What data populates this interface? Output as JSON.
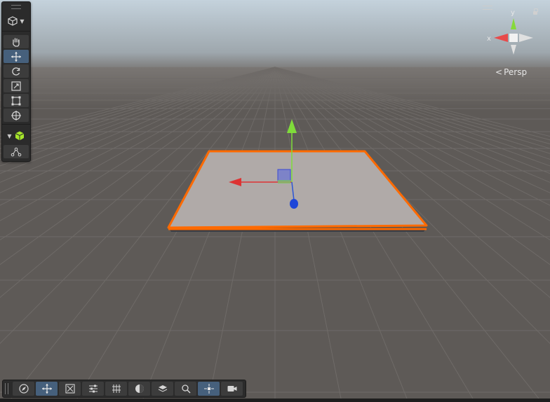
{
  "viewport": {
    "camera_mode_label": "Persp",
    "gizmo_axes": {
      "x": "x",
      "y": "y"
    },
    "sky_color_top": "#bccbd6",
    "ground_color": "#5e5a57",
    "selection_outline_color": "#ff6a00",
    "plane_color": "#b0aaa8"
  },
  "tool_palette": {
    "tools": [
      {
        "name": "hand-tool",
        "icon": "hand-icon",
        "active": false
      },
      {
        "name": "move-tool",
        "icon": "move-arrows-icon",
        "active": true
      },
      {
        "name": "rotate-tool",
        "icon": "rotate-icon",
        "active": false
      },
      {
        "name": "scale-tool",
        "icon": "scale-icon",
        "active": false
      },
      {
        "name": "rect-tool",
        "icon": "rect-transform-icon",
        "active": false
      },
      {
        "name": "transform-tool",
        "icon": "transform-icon",
        "active": false
      }
    ],
    "component_tools": [
      {
        "name": "mesh-tool",
        "icon": "green-cube-icon"
      },
      {
        "name": "path-tool",
        "icon": "nodes-icon"
      }
    ]
  },
  "bottom_toolbar": {
    "buttons": [
      {
        "name": "compass-button",
        "icon": "compass-icon",
        "active": false
      },
      {
        "name": "move-overlay-button",
        "icon": "move-arrows-icon",
        "active": true
      },
      {
        "name": "snap-button",
        "icon": "snap-icon",
        "active": false
      },
      {
        "name": "settings-button",
        "icon": "sliders-icon",
        "active": false
      },
      {
        "name": "grid-button",
        "icon": "grid-icon",
        "active": false
      },
      {
        "name": "shading-button",
        "icon": "shading-icon",
        "active": false
      },
      {
        "name": "layers-button",
        "icon": "layers-icon",
        "active": false
      },
      {
        "name": "search-button",
        "icon": "search-icon",
        "active": false
      },
      {
        "name": "pivot-button",
        "icon": "pivot-icon",
        "active": true
      },
      {
        "name": "camera-button",
        "icon": "camera-icon",
        "active": false
      }
    ]
  }
}
